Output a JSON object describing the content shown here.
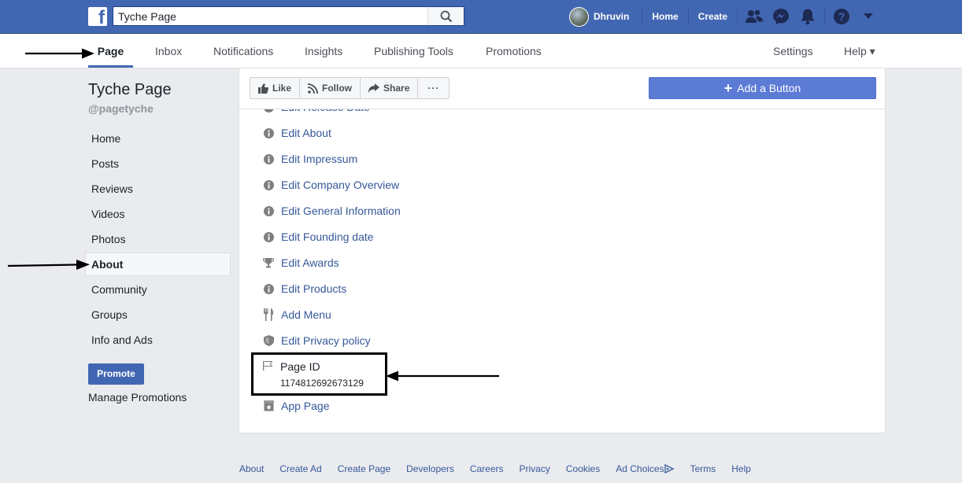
{
  "topbar": {
    "search_value": "Tyche Page",
    "user_name": "Dhruvin",
    "links": [
      "Home",
      "Create"
    ],
    "brand_color": "#4267b2"
  },
  "pagenav": {
    "tabs": [
      "Page",
      "Inbox",
      "Notifications",
      "Insights",
      "Publishing Tools",
      "Promotions"
    ],
    "active_tab": "Page",
    "settings": "Settings",
    "help": "Help ▾"
  },
  "sidebar": {
    "page_name": "Tyche Page",
    "handle": "@pagetyche",
    "items": [
      "Home",
      "Posts",
      "Reviews",
      "Videos",
      "Photos",
      "About",
      "Community",
      "Groups",
      "Info and Ads"
    ],
    "active_item": "About",
    "promote_label": "Promote",
    "manage_promotions": "Manage Promotions"
  },
  "actions": {
    "like": "Like",
    "follow": "Follow",
    "share": "Share",
    "more": "···",
    "add_button": "Add a Button"
  },
  "about": {
    "partial_item": "Edit Release Date",
    "items": [
      {
        "label": "Edit About",
        "icon": "info-icon"
      },
      {
        "label": "Edit Impressum",
        "icon": "info-icon"
      },
      {
        "label": "Edit Company Overview",
        "icon": "info-icon"
      },
      {
        "label": "Edit General Information",
        "icon": "info-icon"
      },
      {
        "label": "Edit Founding date",
        "icon": "info-icon"
      },
      {
        "label": "Edit Awards",
        "icon": "trophy-icon"
      },
      {
        "label": "Edit Products",
        "icon": "info-icon"
      },
      {
        "label": "Add Menu",
        "icon": "fork-knife-icon"
      },
      {
        "label": "Edit Privacy policy",
        "icon": "shield-icon"
      }
    ],
    "page_id_label": "Page ID",
    "page_id_value": "1174812692673129",
    "app_page": "App Page"
  },
  "footer": {
    "links": [
      "About",
      "Create Ad",
      "Create Page",
      "Developers",
      "Careers",
      "Privacy",
      "Cookies",
      "Ad Choices",
      "Terms",
      "Help"
    ]
  }
}
